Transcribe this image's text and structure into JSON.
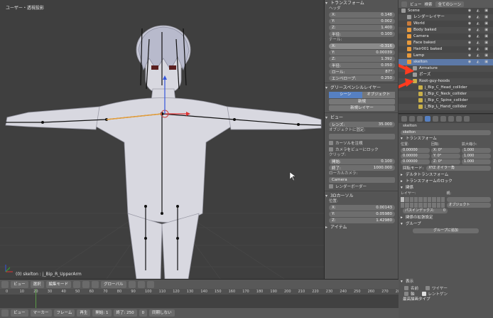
{
  "viewport": {
    "title": "ユーザー・透視投影",
    "status": "(0) skelton : j_Bip_R_UpperArm"
  },
  "npanel": {
    "transform_header": "トランスフォーム",
    "location_label": "ヘッダ",
    "location": [
      {
        "axis": "X:",
        "value": "0.148"
      },
      {
        "axis": "Y:",
        "value": "0.002"
      },
      {
        "axis": "Z:",
        "value": "1.400"
      },
      {
        "axis": "半径:",
        "value": "0.100"
      }
    ],
    "tail_label": "テール:",
    "tail": [
      {
        "axis": "X:",
        "value": "-0.316"
      },
      {
        "axis": "Y:",
        "value": "0.00039"
      },
      {
        "axis": "Z:",
        "value": "1.392"
      },
      {
        "axis": "半径:",
        "value": "0.050"
      },
      {
        "axis": "ロール:",
        "value": "87°"
      },
      {
        "axis": "エンベロープ:",
        "value": "0.250"
      }
    ],
    "grease_header": "グリースペンシルレイヤー",
    "grease_tabs": [
      "シーン",
      "オブジェクト"
    ],
    "grease_new": "新規",
    "grease_new_layer": "新規レイヤー",
    "view_header": "ビュー",
    "lens_label": "レンズ:",
    "lens_value": "35.000",
    "lock_label": "オブジェクトに固定:",
    "lock_cursor": "カーソルを注視",
    "lock_camera": "カメラをビューにロック",
    "clip_label": "クリップ:",
    "clip_start_label": "開始:",
    "clip_start": "0.100",
    "clip_end_label": "終了:",
    "clip_end": "1000.000",
    "local_camera": "ローカルカメラ:",
    "camera_field": "Camera",
    "render_border": "レンダーボーダー",
    "cursor_header": "3Dカーソル",
    "cursor_label": "位置:",
    "cursor": [
      {
        "axis": "X:",
        "value": "0.00143"
      },
      {
        "axis": "Y:",
        "value": "0.05980"
      },
      {
        "axis": "Z:",
        "value": "1.42980"
      }
    ],
    "item_header": "アイテム"
  },
  "outliner": {
    "header_view": "ビュー",
    "header_search": "検索",
    "header_scenes": "全てのシーン",
    "rows": [
      {
        "label": "Scene",
        "depth": 0,
        "color": "#9b9b9b",
        "sel": false
      },
      {
        "label": "レンダーレイヤー",
        "depth": 1,
        "color": "#9b9b9b",
        "sel": false
      },
      {
        "label": "World",
        "depth": 1,
        "color": "#c97b3b",
        "sel": false
      },
      {
        "label": "Body baked",
        "depth": 1,
        "color": "#e89a3c",
        "sel": false
      },
      {
        "label": "Camera",
        "depth": 1,
        "color": "#e89a3c",
        "sel": false
      },
      {
        "label": "Face baked",
        "depth": 1,
        "color": "#e89a3c",
        "sel": false
      },
      {
        "label": "Hair001 baked",
        "depth": 1,
        "color": "#e89a3c",
        "sel": false
      },
      {
        "label": "Lamp",
        "depth": 1,
        "color": "#e89a3c",
        "sel": false
      },
      {
        "label": "skelton",
        "depth": 1,
        "color": "#e89a3c",
        "sel": true
      },
      {
        "label": "Armature",
        "depth": 2,
        "color": "#9b9b9b",
        "sel": false
      },
      {
        "label": "ポーズ",
        "depth": 2,
        "color": "#9b9b9b",
        "sel": false
      },
      {
        "label": "Root-guy-hoods",
        "depth": 2,
        "color": "#c9b04a",
        "sel": false
      },
      {
        "label": "j_Bip_C_Head_collider",
        "depth": 3,
        "color": "#c9b04a",
        "sel": false
      },
      {
        "label": "j_Bip_C_Neck_collider",
        "depth": 3,
        "color": "#c9b04a",
        "sel": false
      },
      {
        "label": "j_Bip_C_Spine_collider",
        "depth": 3,
        "color": "#c9b04a",
        "sel": false
      },
      {
        "label": "j_Bip_L_Hand_collider",
        "depth": 3,
        "color": "#c9b04a",
        "sel": false
      }
    ]
  },
  "props": {
    "breadcrumb": "skelton",
    "name_field": "skelton",
    "transform_header": "トランスフォーム",
    "col_location": "位置:",
    "col_rotation": "回転:",
    "col_scale": "拡大縮小:",
    "loc_values": [
      "0.00000",
      "0.00000",
      "0.00000"
    ],
    "rot_values": [
      "X: 0°",
      "Y: 0°",
      "Z: 0°"
    ],
    "scale_values": [
      "1.000",
      "1.000",
      "1.000"
    ],
    "rotation_mode_label": "回転モード:",
    "rotation_mode": "XYZ オイラー角",
    "delta_header": "デルタトランスフォーム",
    "lock_header": "トランスフォームのロック",
    "relations_header": "関係",
    "layer_label": "レイヤー:",
    "parent_label": "親:",
    "parent_type": "オブジェクト",
    "pass_index": "パスインデックス:",
    "pass_index_value": "0",
    "relations_extra": "関係の拡張設定",
    "group_header": "グループ",
    "add_group": "グループに追加",
    "display_header": "表示",
    "name_label": "名前",
    "axis_label": "軸",
    "wire_label": "ワイヤー",
    "xray_label": "レントゲン",
    "max_draw_type": "最高描画タイプ"
  },
  "bottom": {
    "view_label": "ビュー",
    "select_label": "選択",
    "mode": "編集モード",
    "global": "グローバル",
    "marker_label": "マーカー",
    "frame_label": "フレーム",
    "playback_label": "再生",
    "start_label": "開始:",
    "start_value": "1",
    "end_label": "終了:",
    "end_value": "250",
    "current_value": "0",
    "sync": "同期しない",
    "ticks": [
      "0",
      "10",
      "20",
      "30",
      "40",
      "50",
      "60",
      "70",
      "80",
      "90",
      "100",
      "110",
      "120",
      "130",
      "140",
      "150",
      "160",
      "170",
      "180",
      "190",
      "200",
      "210",
      "220",
      "230",
      "240",
      "250",
      "260",
      "270",
      "280"
    ]
  },
  "colors": {
    "accent": "#5680c2",
    "arrow": "#ff3b1f",
    "bone": "#111111",
    "mesh": "#d6d6de"
  }
}
